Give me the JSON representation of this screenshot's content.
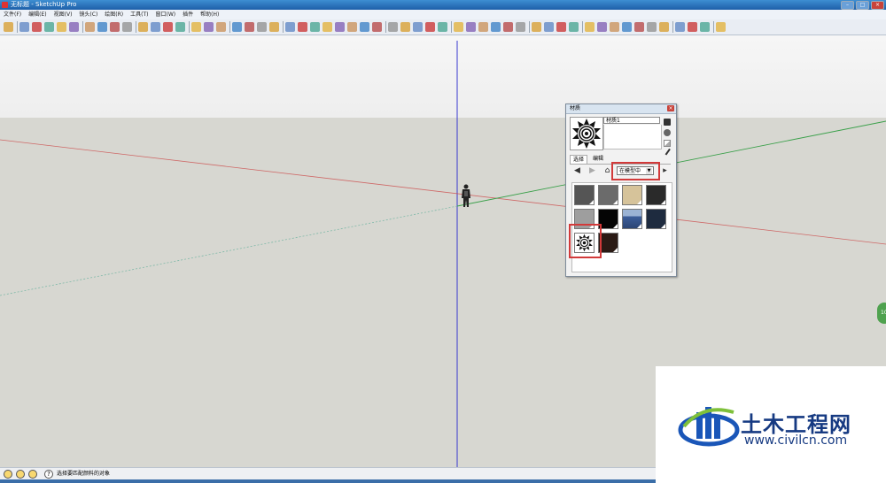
{
  "window": {
    "title": "无标题 - SketchUp Pro",
    "buttons": {
      "minimize": "–",
      "maximize": "□",
      "close": "×"
    }
  },
  "menu": [
    "文件(F)",
    "编辑(E)",
    "视图(V)",
    "镜头(C)",
    "绘图(R)",
    "工具(T)",
    "窗口(W)",
    "插件",
    "帮助(H)"
  ],
  "toolbar": {
    "tools": [
      "select-icon",
      "pencil-icon",
      "rectangle-icon",
      "circle-icon",
      "arc-icon",
      "polygon-icon",
      "eraser-icon",
      "tape-measure-icon",
      "paint-bucket-icon",
      "push-pull-icon",
      "move-icon",
      "rotate-icon",
      "follow-me-icon",
      "offset-icon",
      "orbit-icon",
      "pan-icon",
      "zoom-icon",
      "zoom-extents-icon",
      "previous-view-icon",
      "next-view-icon",
      "standard-views-icon",
      "iso-view-icon",
      "top-view-icon",
      "front-view-icon",
      "right-view-icon",
      "back-view-icon",
      "left-view-icon",
      "x-ray-icon",
      "wireframe-icon",
      "hidden-line-icon",
      "shaded-icon",
      "textured-icon",
      "monochrome-icon",
      "section-plane-icon",
      "walk-icon",
      "position-camera-icon",
      "look-around-icon",
      "shadow-icon",
      "fog-icon",
      "axes-icon",
      "dimension-icon",
      "text-icon",
      "3d-text-icon",
      "protractor-icon",
      "sandbox-from-contours-icon",
      "sandbox-scratch-icon",
      "smoove-icon",
      "stamp-icon",
      "drape-icon",
      "add-detail-icon",
      "flip-edge-icon",
      "get-models-icon",
      "share-model-icon",
      "share-component-icon",
      "help-icon"
    ]
  },
  "colors": {
    "sky": "#eeeeee",
    "ground": "#d7d7d1",
    "axis_red": "#cc4444",
    "axis_green": "#3aa04a",
    "axis_blue": "#3a3ad0",
    "highlight": "#d23a3a"
  },
  "materials_panel": {
    "title": "材质",
    "material_name": "材质1",
    "tabs": [
      "选择",
      "编辑"
    ],
    "collection": "在模型中",
    "nav": {
      "back": "◀",
      "forward": "▶",
      "home": "⌂",
      "details": "▸"
    },
    "swatches": [
      {
        "name": "dark-gray",
        "color": "#555555"
      },
      {
        "name": "medium-gray",
        "color": "#6b6b6b"
      },
      {
        "name": "beige",
        "color": "#d6c39a"
      },
      {
        "name": "charcoal",
        "color": "#2a2a2a"
      },
      {
        "name": "light-gray",
        "color": "#9e9e9e"
      },
      {
        "name": "black",
        "color": "#050505"
      },
      {
        "name": "blue-photo",
        "color": "#4b6fa8"
      },
      {
        "name": "navy",
        "color": "#1e2b3f"
      },
      {
        "name": "starburst-pattern",
        "color": "#ffffff"
      },
      {
        "name": "dark-brown",
        "color": "#2a1a14"
      }
    ]
  },
  "side_badge": "10",
  "status": {
    "text": "选择要匹配颜料的对象",
    "help_glyph": "?"
  },
  "watermark": {
    "name": "土木工程网",
    "url": "www.civilcn.com"
  }
}
